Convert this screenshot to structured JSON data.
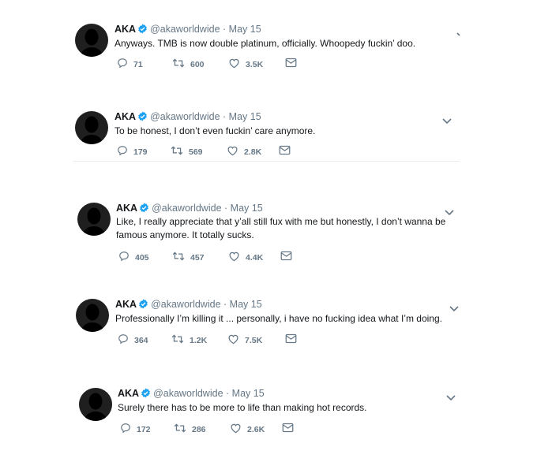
{
  "tweets": [
    {
      "name": "AKA",
      "handle": "@akaworldwide",
      "sep": "·",
      "date": "May 15",
      "text": "Anyways. TMB is now double platinum, officially. Whoopedy fuckin’ doo.",
      "replies": "71",
      "retweets": "600",
      "likes": "3.5K"
    },
    {
      "name": "AKA",
      "handle": "@akaworldwide",
      "sep": "·",
      "date": "May 15",
      "text": "To be honest, I don’t even fuckin’ care anymore.",
      "replies": "179",
      "retweets": "569",
      "likes": "2.8K"
    },
    {
      "name": "AKA",
      "handle": "@akaworldwide",
      "sep": "·",
      "date": "May 15",
      "text": "Like, I really appreciate that y’all still fux with me but honestly, I don’t wanna be famous anymore. It totally sucks.",
      "replies": "405",
      "retweets": "457",
      "likes": "4.4K"
    },
    {
      "name": "AKA",
      "handle": "@akaworldwide",
      "sep": "·",
      "date": "May 15",
      "text": "Professionally I’m killing it ... personally, i have no fucking idea what I’m doing.",
      "replies": "364",
      "retweets": "1.2K",
      "likes": "7.5K"
    },
    {
      "name": "AKA",
      "handle": "@akaworldwide",
      "sep": "·",
      "date": "May 15",
      "text": "Surely there has to be more to life than making hot records.",
      "replies": "172",
      "retweets": "286",
      "likes": "2.6K"
    }
  ],
  "icons": {
    "reply": "reply-icon",
    "retweet": "retweet-icon",
    "like": "heart-icon",
    "dm": "envelope-icon",
    "verified": "verified-badge-icon",
    "more": "chevron-down-icon"
  },
  "colors": {
    "verified": "#1da1f2",
    "meta": "#657786",
    "text": "#14171a"
  }
}
